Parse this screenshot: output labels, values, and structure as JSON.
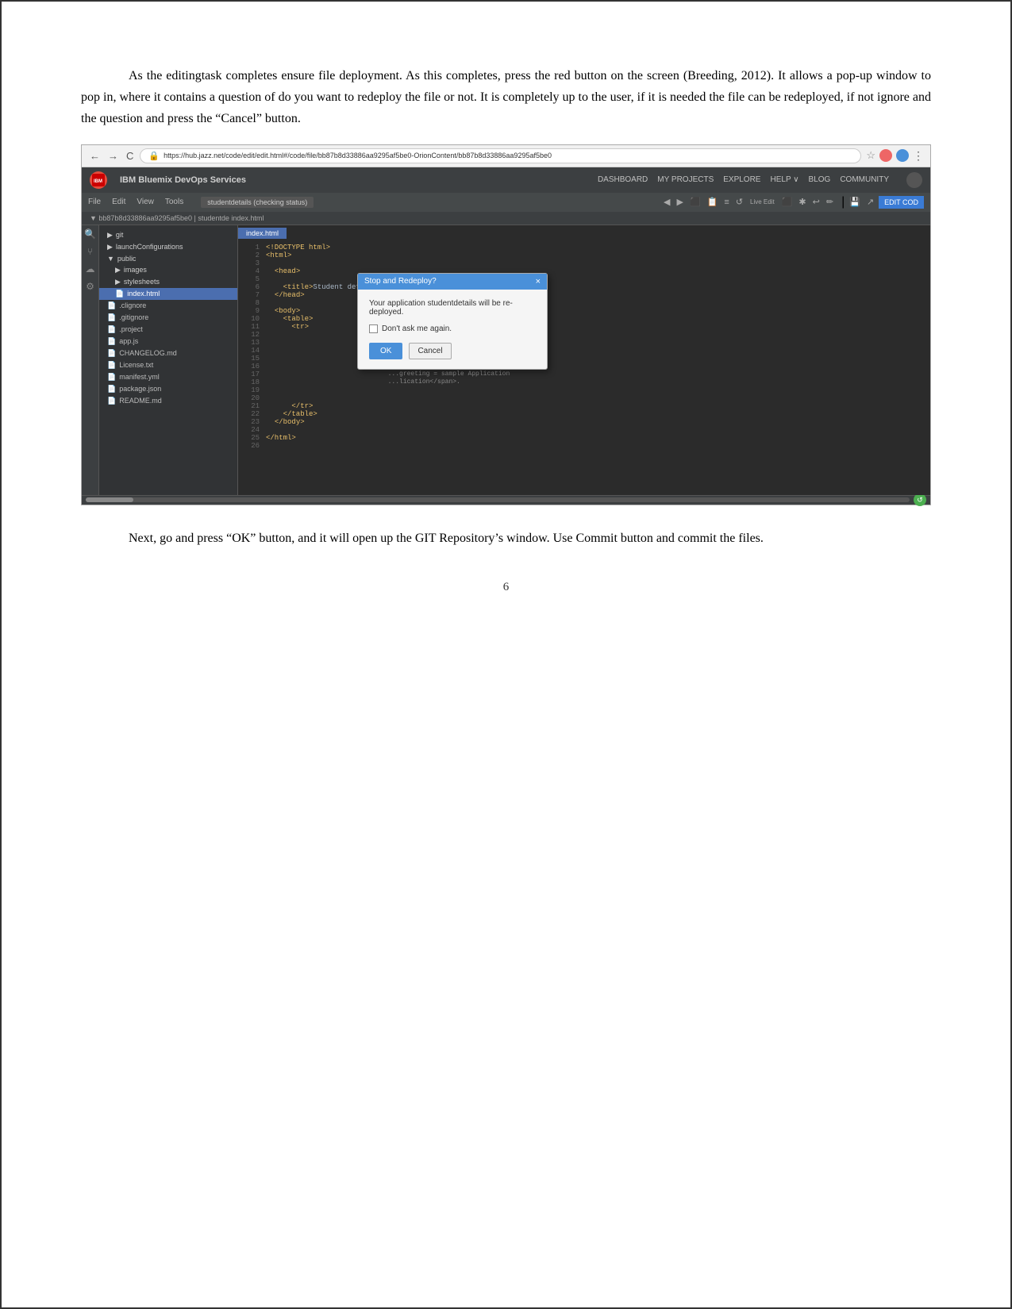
{
  "page": {
    "border_color": "#333",
    "paragraph1": "As the editingtask completes ensure file deployment. As this completes, press the red button on the screen (Breeding, 2012). It allows a pop-up window to pop in, where it contains a question of do you want to redeploy the file or not. It is completely up to the user, if it is needed the file can be redeployed, if not ignore and the question and press the “Cancel” button.",
    "paragraph2": "Next, go and press “OK” button, and it will open up the GIT Repository’s window. Use Commit button and commit the files.",
    "page_number": "6"
  },
  "browser": {
    "back_label": "←",
    "forward_label": "→",
    "reload_label": "C",
    "url": "https://hub.jazz.net/code/edit/edit.html#/code/file/bb87b8d33886aa9295af5be0-OrionContent/bb87b8d33886aa9295af5be0",
    "star_label": "☆",
    "firefox_label": "●",
    "more_label": "⋮"
  },
  "ide": {
    "logo_label": "IBM",
    "brand": "IBM Bluemix DevOps Services",
    "nav_links": [
      "DASHBOARD",
      "MY PROJECTS",
      "EXPLORE",
      "HELP ∨",
      "BLOG",
      "COMMUNITY"
    ],
    "menu_items": [
      "File",
      "Edit",
      "View",
      "Tools"
    ],
    "file_tab_label": "studentdetails (checking status)",
    "edit_code_btn": "EDIT COD",
    "breadcrumb": "▼ bb87b8d33886aa9295af5be0 | studentde         index.html",
    "sidebar_items": [
      {
        "label": "► git",
        "indent": 1
      },
      {
        "label": "► launchConfigurations",
        "indent": 1
      },
      {
        "label": "▼ public",
        "indent": 1
      },
      {
        "label": "► images",
        "indent": 2
      },
      {
        "label": "► stylesheets",
        "indent": 2
      },
      {
        "label": "📄 index.html",
        "indent": 2,
        "active": true
      },
      {
        "label": "📄 .clignore",
        "indent": 1
      },
      {
        "label": "📄 .gitignore",
        "indent": 1
      },
      {
        "label": "📄 .project",
        "indent": 1
      },
      {
        "label": "📄 app.js",
        "indent": 1
      },
      {
        "label": "📄 CHANGELOG.md",
        "indent": 1
      },
      {
        "label": "📄 License.txt",
        "indent": 1
      },
      {
        "label": "📄 manifest.yml",
        "indent": 1
      },
      {
        "label": "📄 package.json",
        "indent": 1
      },
      {
        "label": "📄 README.md",
        "indent": 1
      }
    ],
    "code_lines": [
      {
        "num": "1",
        "code": "<!DOCTYPE html>"
      },
      {
        "num": "2",
        "code": "<html>"
      },
      {
        "num": "3",
        "code": ""
      },
      {
        "num": "4",
        "code": "  <head>"
      },
      {
        "num": "5",
        "code": ""
      },
      {
        "num": "6",
        "code": "    <title>Student details</title>"
      },
      {
        "num": "7",
        "code": "  </head>"
      },
      {
        "num": "8",
        "code": ""
      },
      {
        "num": "9",
        "code": "  <body>"
      },
      {
        "num": "10",
        "code": "    <table>"
      },
      {
        "num": "11",
        "code": "      <tr>"
      },
      {
        "num": "12",
        "code": ""
      },
      {
        "num": "13",
        "code": ""
      },
      {
        "num": "14",
        "code": ""
      },
      {
        "num": "15",
        "code": ""
      },
      {
        "num": "16",
        "code": ""
      },
      {
        "num": "17",
        "code": ""
      },
      {
        "num": "18",
        "code": ""
      },
      {
        "num": "19",
        "code": ""
      },
      {
        "num": "20",
        "code": ""
      },
      {
        "num": "21",
        "code": "    </tr>"
      },
      {
        "num": "22",
        "code": "    </table>"
      },
      {
        "num": "23",
        "code": "  </body>"
      },
      {
        "num": "24",
        "code": ""
      },
      {
        "num": "25",
        "code": "</html>"
      },
      {
        "num": "26",
        "code": ""
      }
    ],
    "dialog": {
      "title": "Stop and Redeploy?",
      "close_label": "×",
      "body_text": "Your application studentdetails will be re-deployed.",
      "checkbox_label": "Don't ask me again.",
      "ok_label": "OK",
      "cancel_label": "Cancel"
    },
    "activity_icons": [
      "⚙",
      "🔍",
      "🗂",
      "🔗"
    ]
  }
}
